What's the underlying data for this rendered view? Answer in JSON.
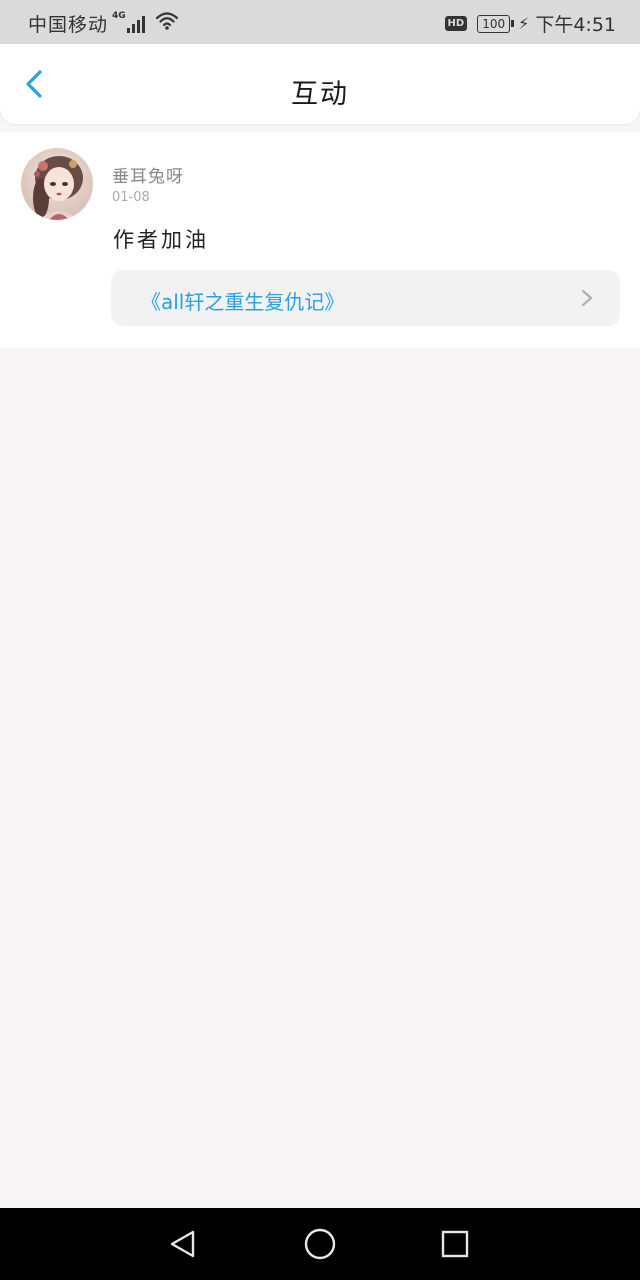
{
  "status_bar": {
    "carrier": "中国移动",
    "network": "4G",
    "hd": "HD",
    "battery": "100",
    "time": "下午4:51"
  },
  "header": {
    "title": "互动",
    "back_icon": "chevron-left-icon"
  },
  "interaction": {
    "username": "垂耳兔呀",
    "date": "01-08",
    "comment": "作者加油",
    "book_title": "《all轩之重生复仇记》"
  },
  "colors": {
    "accent": "#2aa0e0",
    "background": "#f8f6f6",
    "status_bar": "#dadada",
    "nav_bar": "#000000"
  },
  "nav": {
    "back_icon": "triangle-back-icon",
    "home_icon": "circle-home-icon",
    "recents_icon": "square-recents-icon"
  }
}
